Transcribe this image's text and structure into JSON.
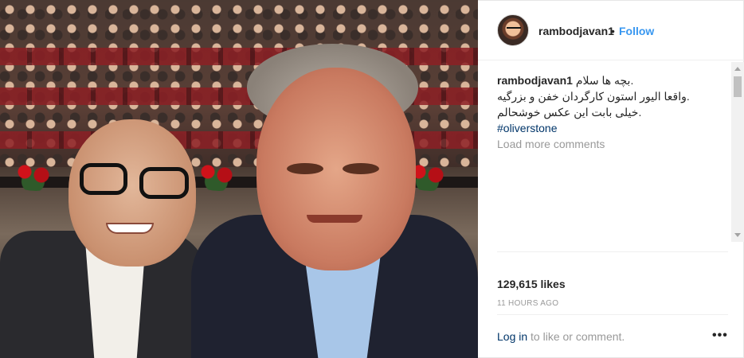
{
  "post": {
    "username": "rambodjavan1",
    "separator": "•",
    "follow_label": "Follow",
    "caption": {
      "user": "rambodjavan1",
      "line1": "بچه ها سلام.",
      "line2": "واقعا الیور استون کارگردان خفن و بزرگیه.",
      "line3": "خیلی بابت این عکس خوشحالم.",
      "hashtag": "#oliverstone"
    },
    "load_more_label": "Load more comments",
    "likes": "129,615 likes",
    "timestamp": "11 HOURS AGO",
    "login_link": "Log in",
    "login_rest": " to like or comment.",
    "more_options": "•••"
  },
  "icons": {
    "more": "more-options-icon",
    "avatar": "avatar"
  },
  "colors": {
    "link": "#3897f0",
    "hashtag": "#003569",
    "muted": "#999999"
  }
}
